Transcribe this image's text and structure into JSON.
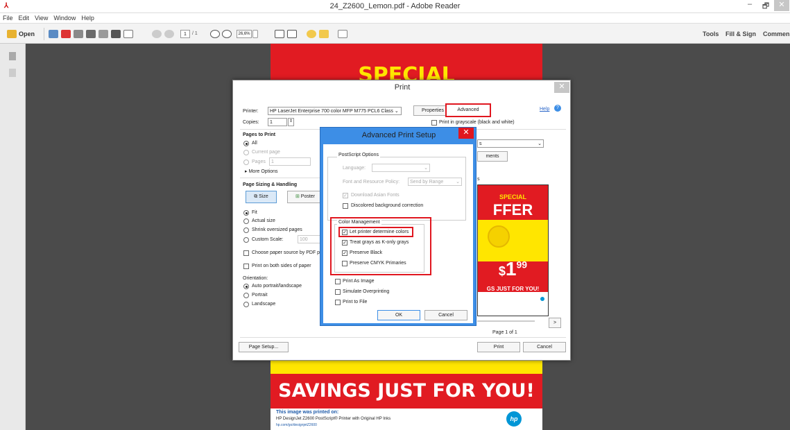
{
  "window": {
    "title": "24_Z2600_Lemon.pdf - Adobe Reader",
    "min": "–",
    "max": "🗗",
    "close": "✕"
  },
  "menu": [
    "File",
    "Edit",
    "View",
    "Window",
    "Help"
  ],
  "toolbar": {
    "open": "Open",
    "page_current": "1",
    "page_total": "/ 1",
    "zoom": "26,6%",
    "tools": "Tools",
    "fill_sign": "Fill & Sign",
    "comment": "Commen"
  },
  "document": {
    "special": "SPECIAL",
    "savings": "SAVINGS JUST FOR YOU!",
    "footer_title": "This image was printed on:",
    "footer_line": "HP DesignJet Z2600 PostScript® Printer with Original HP Inks",
    "footer_url": "hp.com/go/designjetZ2600",
    "hp": "hp"
  },
  "print": {
    "title": "Print",
    "printer_label": "Printer:",
    "printer_value": "HP LaserJet Enterprise 700 color MFP M775 PCL6 Class",
    "properties": "Properties",
    "advanced": "Advanced",
    "help": "Help",
    "copies_label": "Copies:",
    "copies_value": "1",
    "grayscale": "Print in grayscale (black and white)",
    "pages_to_print": "Pages to Print",
    "all": "All",
    "current_page": "Current page",
    "pages": "Pages",
    "pages_value": "1",
    "more_options": "More Options",
    "sizing": "Page Sizing & Handling",
    "size": "Size",
    "poster": "Poster",
    "fit": "Fit",
    "actual_size": "Actual size",
    "shrink": "Shrink oversized pages",
    "custom_scale": "Custom Scale:",
    "custom_scale_value": "100",
    "choose_paper": "Choose paper source by PDF pa",
    "both_sides": "Print on both sides of paper",
    "orientation": "Orientation:",
    "auto": "Auto portrait/landscape",
    "portrait": "Portrait",
    "landscape": "Landscape",
    "comments_fragment": "s",
    "ments_fragment": "ments",
    "preview_special": "SPECIAL",
    "preview_offer": "FFER",
    "preview_price": "1",
    "preview_cents": "99",
    "preview_dollar": "$",
    "preview_savings": "GS JUST FOR YOU!",
    "page_of": "Page 1 of 1",
    "nav_next": ">",
    "page_setup": "Page Setup...",
    "print_btn": "Print",
    "cancel_btn": "Cancel"
  },
  "advanced": {
    "title": "Advanced Print Setup",
    "close": "✕",
    "ps_options": "PostScript Options",
    "language": "Language:",
    "font_policy": "Font and Resource Policy:",
    "font_policy_value": "Send by Range",
    "download_asian": "Download Asian Fonts",
    "discolored": "Discolored background correction",
    "color_mgmt": "Color Management",
    "let_printer": "Let printer determine colors",
    "treat_grays": "Treat grays as K-only grays",
    "preserve_black": "Preserve Black",
    "preserve_cmyk": "Preserve CMYK Primaries",
    "print_as_image": "Print As Image",
    "simulate": "Simulate Overprinting",
    "print_to_file": "Print to File",
    "ok": "OK",
    "cancel": "Cancel"
  },
  "colors": {
    "highlight": "#e0161f",
    "brand_red": "#e11b22",
    "brand_yellow": "#ffe600",
    "dialog_blue": "#3d8ee6"
  }
}
